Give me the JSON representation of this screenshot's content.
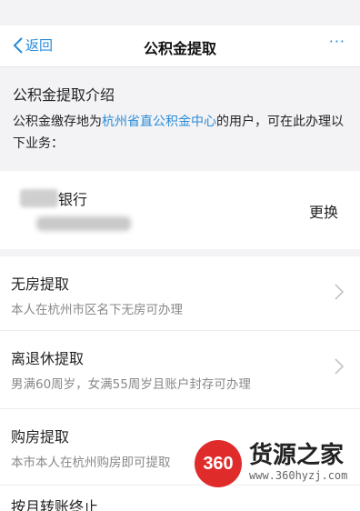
{
  "nav": {
    "back_label": "返回",
    "title": "公积金提取",
    "more_label": "···"
  },
  "intro": {
    "heading": "公积金提取介绍",
    "text_prefix": "公积金缴存地为",
    "text_link": "杭州省直公积金中心",
    "text_suffix": "的用户，可在此办理以下业务："
  },
  "bank": {
    "name": "银行",
    "change_label": "更换"
  },
  "items": [
    {
      "title": "无房提取",
      "desc": "本人在杭州市区名下无房可办理"
    },
    {
      "title": "离退休提取",
      "desc": "男满60周岁，女满55周岁且账户封存可办理"
    },
    {
      "title": "购房提取",
      "desc": "本市本人在杭州购房即可提取"
    },
    {
      "title": "按月转账终止",
      "desc": ""
    }
  ],
  "watermark": {
    "badge": "360",
    "name": "货源之家",
    "url": "www.360hyzj.com"
  },
  "colors": {
    "accent": "#2a8bd8",
    "watermark_red": "#e02b2b"
  }
}
